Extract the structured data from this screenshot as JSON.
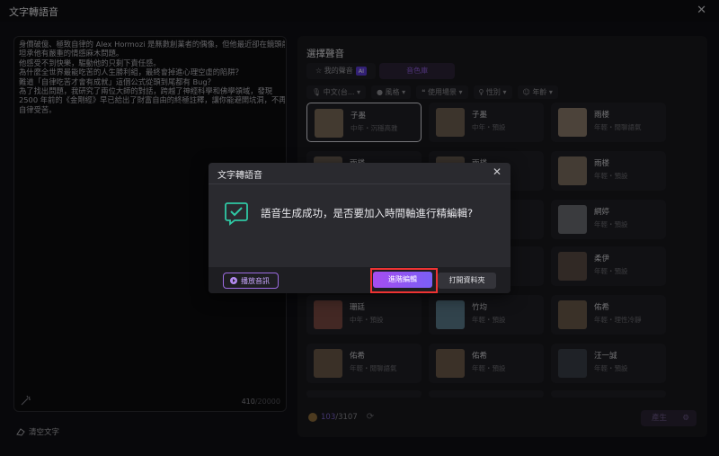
{
  "window": {
    "title": "文字轉語音",
    "close_symbol": "✕"
  },
  "editor": {
    "lines": [
      "身價破億、極致自律的 Alex Hormozi 是無數創業者的偶像，但他最近卻在鏡頭前",
      "坦承他有嚴重的情感麻木問題。",
      "他感受不到快樂，驅動他的只剩下責任感。",
      "為什麼全世界最能吃苦的人生勝利組，最終會掉進心理空虛的陷阱？",
      "難道「自律吃苦才會有成就」這個公式從頭到尾都有 Bug？",
      "為了找出問題，我研究了兩位大師的對話，跨越了神經科學和佛學領域，發現",
      "2500 年前的《金剛經》早已給出了財富自由的終極註釋，讓你能避開坑洞，不再為",
      "自律受苦。"
    ],
    "char_count": "410",
    "char_max": "/20000"
  },
  "clear_text_label": "清空文字",
  "voice_panel": {
    "heading": "選擇聲音",
    "tabs": {
      "my_voice": "我的聲音",
      "ai_badge": "AI",
      "tone": "音色庫"
    },
    "filters": [
      "中文(台...",
      "風格",
      "使用場景",
      "性別",
      "年齡"
    ],
    "cards": [
      {
        "name": "子墨",
        "desc": "中年・沉穩高雅",
        "avatar_color": "#7a6a58"
      },
      {
        "name": "子墨",
        "desc": "中年・預設",
        "avatar_color": "#6e6050"
      },
      {
        "name": "雨楼",
        "desc": "年輕・閒聊語氣",
        "avatar_color": "#8a7a6a"
      },
      {
        "name": "雨楼",
        "desc": "",
        "avatar_color": "#6a5e52"
      },
      {
        "name": "雨楼",
        "desc": "",
        "avatar_color": "#685c50"
      },
      {
        "name": "雨楼",
        "desc": "年輕・預設",
        "avatar_color": "#7c6e60"
      },
      {
        "name": "網婷",
        "desc": "年輕・預設",
        "avatar_color": "#6a6c72"
      },
      {
        "name": "柔伊",
        "desc": "年輕・預設",
        "avatar_color": "#5a4c44"
      },
      {
        "name": "珊廷",
        "desc": "中年・預設",
        "avatar_color": "#7a4a42"
      },
      {
        "name": "竹均",
        "desc": "年輕・預設",
        "avatar_color": "#5a7a8a"
      },
      {
        "name": "佑希",
        "desc": "年輕・理性冷靜",
        "avatar_color": "#6a5a4a"
      },
      {
        "name": "佑希",
        "desc": "年輕・閒聊語氣",
        "avatar_color": "#6a5848"
      },
      {
        "name": "佑希",
        "desc": "年輕・預設",
        "avatar_color": "#6c5a4a"
      },
      {
        "name": "汪一誠",
        "desc": "年輕・預設",
        "avatar_color": "#3a3e48"
      }
    ],
    "credits_used": "103",
    "credits_total": "/3107",
    "generate_label": "產生"
  },
  "dialog": {
    "title": "文字轉語音",
    "close_symbol": "✕",
    "message": "語音生成成功，是否要加入時間軸進行精編輯?",
    "play_label": "播放音訊",
    "advanced_edit_label": "進階編輯",
    "open_folder_label": "打開資料夾"
  },
  "colors": {
    "accent": "#9b6be0",
    "highlight": "#e33333",
    "check": "#2fc8a4"
  }
}
